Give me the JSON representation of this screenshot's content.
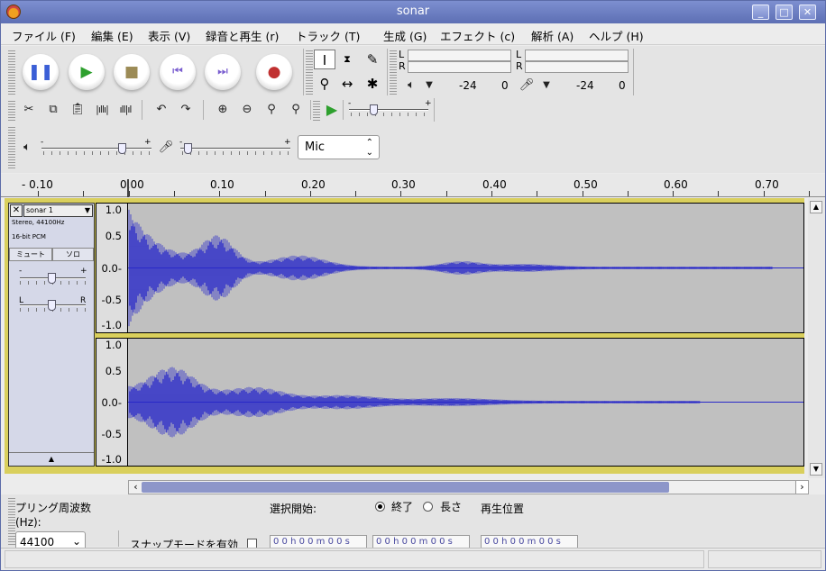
{
  "window": {
    "title": "sonar",
    "controls": {
      "minimize": "_",
      "maximize": "□",
      "close": "✕"
    }
  },
  "menu": [
    "ファイル (F)",
    "編集 (E)",
    "表示 (V)",
    "録音と再生 (r)",
    "トラック (T)",
    "生成 (G)",
    "エフェクト (c)",
    "解析 (A)",
    "ヘルプ (H)"
  ],
  "transport": {
    "pause_icon": "pause-icon",
    "play_icon": "play-icon",
    "stop_icon": "stop-icon",
    "skip_start_icon": "skip-to-start-icon",
    "skip_end_icon": "skip-to-end-icon",
    "record_icon": "record-icon",
    "colors": {
      "pause": "#3b5fd6",
      "play": "#2ea02e",
      "stop": "#9c8b56",
      "skip": "#7b5fd0",
      "record": "#c03030"
    }
  },
  "meters": {
    "playback": {
      "L": "L",
      "R": "R",
      "value_a": "-24",
      "value_b": "0"
    },
    "record": {
      "L": "L",
      "R": "R",
      "value_a": "-24",
      "value_b": "0"
    }
  },
  "mixer": {
    "output_volume_level": 0.72,
    "input_volume_level": 0.03,
    "input_source": "Mic",
    "plus": "+",
    "minus": "-"
  },
  "ruler": {
    "labels": [
      "- 0.10",
      "0.00",
      "0.10",
      "0.20",
      "0.30",
      "0.40",
      "0.50",
      "0.60",
      "0.70"
    ]
  },
  "track": {
    "name": "sonar 1",
    "info_line1": "Stereo, 44100Hz",
    "info_line2": "16-bit PCM",
    "mute": "ミュート",
    "solo": "ソロ",
    "gain_minus": "-",
    "gain_plus": "+",
    "pan_left": "L",
    "pan_right": "R",
    "close": "✕",
    "collapse": "▲",
    "wave_color": "#2828c8",
    "channel1_labels": [
      "1.0",
      "0.5",
      "0.0-",
      "-0.5",
      "-1.0"
    ],
    "channel2_labels": [
      "1.0",
      "0.5",
      "0.0-",
      "-0.5",
      "-1.0"
    ]
  },
  "selection": {
    "rate_label_1": "プリング周波数",
    "rate_label_2": "(Hz):",
    "rate_value": "44100",
    "snap_label": "スナップモードを有効",
    "start_label": "選択開始:",
    "end_label": "終了",
    "length_label": "長さ",
    "position_label": "再生位置",
    "time1": "0 0 h 0 0 m 0 0 s",
    "time2": "0 0 h 0 0 m 0 0 s",
    "time3": "0 0 h 0 0 m 0 0 s"
  }
}
